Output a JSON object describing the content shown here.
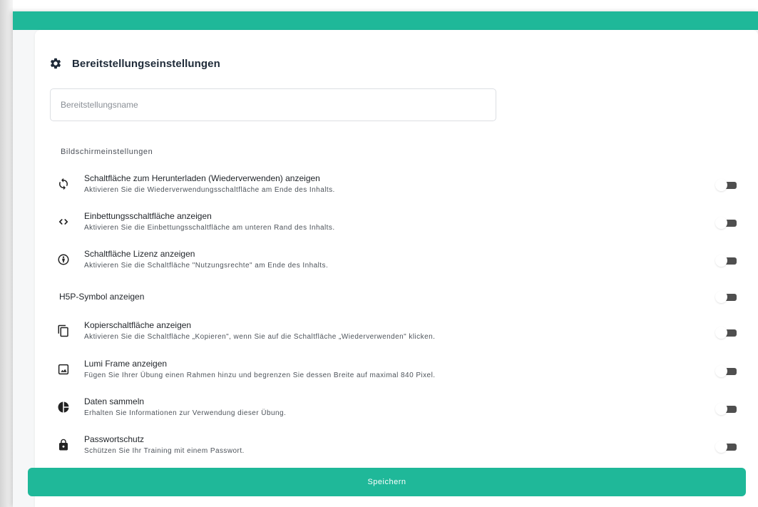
{
  "colors": {
    "accent": "#1fb899",
    "toggle_track": "#4f4f4f"
  },
  "card": {
    "title": "Bereitstellungseinstellungen",
    "icon": "gear-icon"
  },
  "name_input": {
    "value": "",
    "placeholder": "Bereitstellungsname"
  },
  "section": {
    "label": "Bildschirmeinstellungen"
  },
  "settings": [
    {
      "icon": "reuse-icon",
      "title": "Schaltfläche zum Herunterladen (Wiederverwenden) anzeigen",
      "description": "Aktivieren Sie die Wiederverwendungsschaltfläche am Ende des Inhalts.",
      "enabled": false
    },
    {
      "icon": "embed-code-icon",
      "title": "Einbettungsschaltfläche anzeigen",
      "description": "Aktivieren Sie die Einbettungsschaltfläche am unteren Rand des Inhalts.",
      "enabled": false
    },
    {
      "icon": "license-icon",
      "title": "Schaltfläche Lizenz anzeigen",
      "description": "Aktivieren Sie die Schaltfläche \"Nutzungsrechte\" am Ende des Inhalts.",
      "enabled": false
    },
    {
      "icon": "",
      "title": "H5P-Symbol anzeigen",
      "description": "",
      "enabled": false
    },
    {
      "icon": "copy-icon",
      "title": "Kopierschaltfläche anzeigen",
      "description": "Aktivieren Sie die Schaltfläche „Kopieren\", wenn Sie auf die Schaltfläche „Wiederverwenden\" klicken.",
      "enabled": false
    },
    {
      "icon": "frame-icon",
      "title": "Lumi Frame anzeigen",
      "description": "Fügen Sie Ihrer Übung einen Rahmen hinzu und begrenzen Sie dessen Breite auf maximal 840 Pixel.",
      "enabled": false
    },
    {
      "icon": "pie-chart-icon",
      "title": "Daten sammeln",
      "description": "Erhalten Sie Informationen zur Verwendung dieser Übung.",
      "enabled": false
    },
    {
      "icon": "lock-icon",
      "title": "Passwortschutz",
      "description": "Schützen Sie Ihr Training mit einem Passwort.",
      "enabled": false
    }
  ],
  "save_button": {
    "label": "Speichern"
  }
}
